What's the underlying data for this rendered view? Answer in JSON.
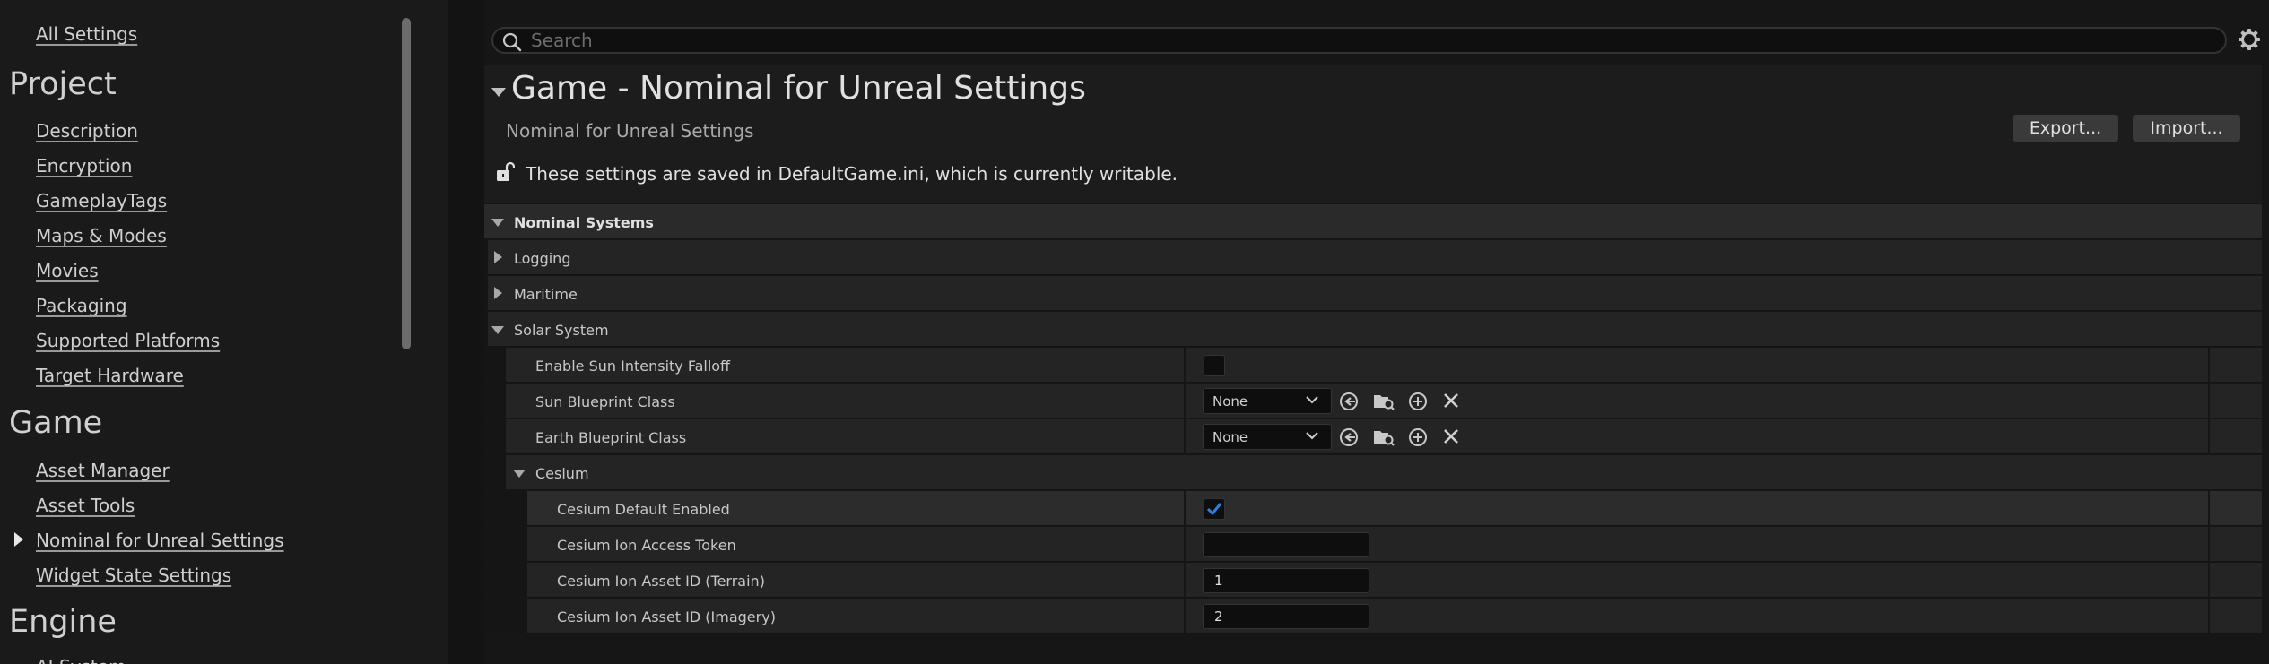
{
  "sidebar": {
    "all_settings": "All Settings",
    "project": {
      "title": "Project",
      "items": [
        "Description",
        "Encryption",
        "GameplayTags",
        "Maps & Modes",
        "Movies",
        "Packaging",
        "Supported Platforms",
        "Target Hardware"
      ]
    },
    "game": {
      "title": "Game",
      "items": [
        "Asset Manager",
        "Asset Tools",
        "Nominal for Unreal Settings",
        "Widget State Settings"
      ],
      "selected": "Nominal for Unreal Settings"
    },
    "engine": {
      "title": "Engine",
      "first_item_partial": "AI System"
    }
  },
  "search": {
    "placeholder": "Search",
    "value": ""
  },
  "header": {
    "title": "Game - Nominal for Unreal Settings",
    "subtitle": "Nominal for Unreal Settings",
    "export_label": "Export...",
    "import_label": "Import...",
    "writable_note": "These settings are saved in DefaultGame.ini, which is currently writable."
  },
  "grid": {
    "section": "Nominal Systems",
    "logging": "Logging",
    "maritime": "Maritime",
    "solar_system": {
      "label": "Solar System",
      "enable_sun_falloff": {
        "label": "Enable Sun Intensity Falloff",
        "checked": false
      },
      "sun_blueprint": {
        "label": "Sun Blueprint Class",
        "value": "None"
      },
      "earth_blueprint": {
        "label": "Earth Blueprint Class",
        "value": "None"
      },
      "cesium": {
        "label": "Cesium",
        "default_enabled": {
          "label": "Cesium Default Enabled",
          "checked": true
        },
        "ion_token": {
          "label": "Cesium Ion Access Token",
          "value": ""
        },
        "terrain_id": {
          "label": "Cesium Ion Asset ID (Terrain)",
          "value": "1"
        },
        "imagery_id": {
          "label": "Cesium Ion Asset ID (Imagery)",
          "value": "2"
        }
      }
    }
  },
  "colors": {
    "accent": "#2f7fd8",
    "background": "#151515",
    "row": "#242424"
  }
}
